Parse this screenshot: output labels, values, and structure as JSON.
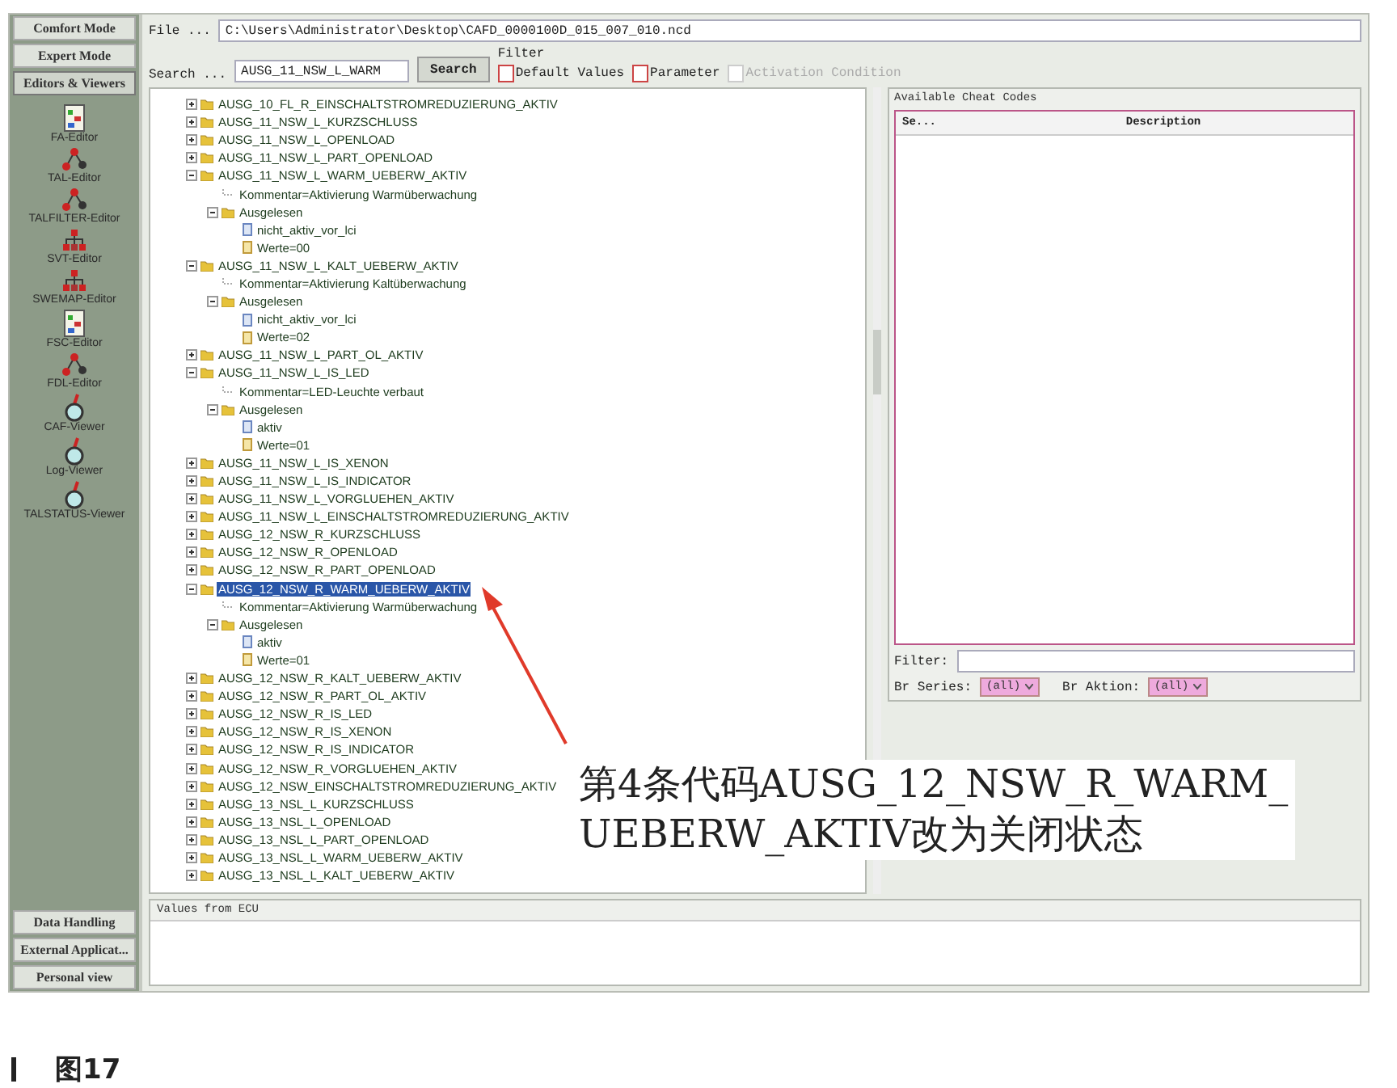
{
  "sidebar": {
    "modes": [
      {
        "label": "Comfort Mode",
        "selected": false
      },
      {
        "label": "Expert Mode",
        "selected": false
      },
      {
        "label": "Editors & Viewers",
        "selected": true
      }
    ],
    "tools": [
      {
        "label": "FA-Editor",
        "kind": "sheet"
      },
      {
        "label": "TAL-Editor",
        "kind": "network"
      },
      {
        "label": "TALFILTER-Editor",
        "kind": "network"
      },
      {
        "label": "SVT-Editor",
        "kind": "hierarchy"
      },
      {
        "label": "SWEMAP-Editor",
        "kind": "hierarchy"
      },
      {
        "label": "FSC-Editor",
        "kind": "sheet"
      },
      {
        "label": "FDL-Editor",
        "kind": "network"
      },
      {
        "label": "CAF-Viewer",
        "kind": "lens"
      },
      {
        "label": "Log-Viewer",
        "kind": "lens"
      },
      {
        "label": "TALSTATUS-Viewer",
        "kind": "lens"
      }
    ],
    "bottom": [
      {
        "label": "Data Handling",
        "selected": false
      },
      {
        "label": "External Applicat...",
        "selected": false
      },
      {
        "label": "Personal view",
        "selected": false
      }
    ]
  },
  "file": {
    "label": "File ...",
    "value": "C:\\Users\\Administrator\\Desktop\\CAFD_0000100D_015_007_010.ncd"
  },
  "search": {
    "label": "Search ...",
    "value": "AUSG_11_NSW_L_WARM",
    "button": "Search"
  },
  "filter": {
    "title": "Filter",
    "options": [
      {
        "label": "Default Values",
        "checked": false,
        "disabled": false
      },
      {
        "label": "Parameter",
        "checked": false,
        "disabled": false
      },
      {
        "label": "Activation Condition",
        "checked": false,
        "disabled": true
      }
    ]
  },
  "tree": [
    {
      "label": "AUSG_10_FL_R_EINSCHALTSTROMREDUZIERUNG_AKTIV",
      "kind": "folder",
      "expanded": false,
      "selected": false
    },
    {
      "label": "AUSG_11_NSW_L_KURZSCHLUSS",
      "kind": "folder",
      "expanded": false,
      "selected": false
    },
    {
      "label": "AUSG_11_NSW_L_OPENLOAD",
      "kind": "folder",
      "expanded": false,
      "selected": false
    },
    {
      "label": "AUSG_11_NSW_L_PART_OPENLOAD",
      "kind": "folder",
      "expanded": false,
      "selected": false
    },
    {
      "label": "AUSG_11_NSW_L_WARM_UEBERW_AKTIV",
      "kind": "folder",
      "expanded": true,
      "selected": false,
      "children": [
        {
          "label": "Kommentar=Aktivierung Warmüberwachung",
          "kind": "comment",
          "selected": false
        },
        {
          "label": "Ausgelesen",
          "kind": "folder",
          "expanded": true,
          "selected": false,
          "children": [
            {
              "label": "nicht_aktiv_vor_lci",
              "kind": "status",
              "selected": false
            },
            {
              "label": "Werte=00",
              "kind": "value",
              "selected": false
            }
          ]
        }
      ]
    },
    {
      "label": "AUSG_11_NSW_L_KALT_UEBERW_AKTIV",
      "kind": "folder",
      "expanded": true,
      "selected": false,
      "children": [
        {
          "label": "Kommentar=Aktivierung Kaltüberwachung",
          "kind": "comment",
          "selected": false
        },
        {
          "label": "Ausgelesen",
          "kind": "folder",
          "expanded": true,
          "selected": false,
          "children": [
            {
              "label": "nicht_aktiv_vor_lci",
              "kind": "status",
              "selected": false
            },
            {
              "label": "Werte=02",
              "kind": "value",
              "selected": false
            }
          ]
        }
      ]
    },
    {
      "label": "AUSG_11_NSW_L_PART_OL_AKTIV",
      "kind": "folder",
      "expanded": false,
      "selected": false
    },
    {
      "label": "AUSG_11_NSW_L_IS_LED",
      "kind": "folder",
      "expanded": true,
      "selected": false,
      "children": [
        {
          "label": "Kommentar=LED-Leuchte verbaut",
          "kind": "comment",
          "selected": false
        },
        {
          "label": "Ausgelesen",
          "kind": "folder",
          "expanded": true,
          "selected": false,
          "children": [
            {
              "label": "aktiv",
              "kind": "status",
              "selected": false
            },
            {
              "label": "Werte=01",
              "kind": "value",
              "selected": false
            }
          ]
        }
      ]
    },
    {
      "label": "AUSG_11_NSW_L_IS_XENON",
      "kind": "folder",
      "expanded": false,
      "selected": false
    },
    {
      "label": "AUSG_11_NSW_L_IS_INDICATOR",
      "kind": "folder",
      "expanded": false,
      "selected": false
    },
    {
      "label": "AUSG_11_NSW_L_VORGLUEHEN_AKTIV",
      "kind": "folder",
      "expanded": false,
      "selected": false
    },
    {
      "label": "AUSG_11_NSW_L_EINSCHALTSTROMREDUZIERUNG_AKTIV",
      "kind": "folder",
      "expanded": false,
      "selected": false
    },
    {
      "label": "AUSG_12_NSW_R_KURZSCHLUSS",
      "kind": "folder",
      "expanded": false,
      "selected": false
    },
    {
      "label": "AUSG_12_NSW_R_OPENLOAD",
      "kind": "folder",
      "expanded": false,
      "selected": false
    },
    {
      "label": "AUSG_12_NSW_R_PART_OPENLOAD",
      "kind": "folder",
      "expanded": false,
      "selected": false
    },
    {
      "label": "AUSG_12_NSW_R_WARM_UEBERW_AKTIV",
      "kind": "folder",
      "expanded": true,
      "selected": true,
      "children": [
        {
          "label": "Kommentar=Aktivierung Warmüberwachung",
          "kind": "comment",
          "selected": false
        },
        {
          "label": "Ausgelesen",
          "kind": "folder",
          "expanded": true,
          "selected": false,
          "children": [
            {
              "label": "aktiv",
              "kind": "status",
              "selected": false
            },
            {
              "label": "Werte=01",
              "kind": "value",
              "selected": false
            }
          ]
        }
      ]
    },
    {
      "label": "AUSG_12_NSW_R_KALT_UEBERW_AKTIV",
      "kind": "folder",
      "expanded": false,
      "selected": false
    },
    {
      "label": "AUSG_12_NSW_R_PART_OL_AKTIV",
      "kind": "folder",
      "expanded": false,
      "selected": false
    },
    {
      "label": "AUSG_12_NSW_R_IS_LED",
      "kind": "folder",
      "expanded": false,
      "selected": false
    },
    {
      "label": "AUSG_12_NSW_R_IS_XENON",
      "kind": "folder",
      "expanded": false,
      "selected": false
    },
    {
      "label": "AUSG_12_NSW_R_IS_INDICATOR",
      "kind": "folder",
      "expanded": false,
      "selected": false
    },
    {
      "label": "AUSG_12_NSW_R_VORGLUEHEN_AKTIV",
      "kind": "folder",
      "expanded": false,
      "selected": false
    },
    {
      "label": "AUSG_12_NSW_EINSCHALTSTROMREDUZIERUNG_AKTIV",
      "kind": "folder",
      "expanded": false,
      "selected": false
    },
    {
      "label": "AUSG_13_NSL_L_KURZSCHLUSS",
      "kind": "folder",
      "expanded": false,
      "selected": false
    },
    {
      "label": "AUSG_13_NSL_L_OPENLOAD",
      "kind": "folder",
      "expanded": false,
      "selected": false
    },
    {
      "label": "AUSG_13_NSL_L_PART_OPENLOAD",
      "kind": "folder",
      "expanded": false,
      "selected": false
    },
    {
      "label": "AUSG_13_NSL_L_WARM_UEBERW_AKTIV",
      "kind": "folder",
      "expanded": false,
      "selected": false
    },
    {
      "label": "AUSG_13_NSL_L_KALT_UEBERW_AKTIV",
      "kind": "folder",
      "expanded": false,
      "selected": false
    }
  ],
  "cheat_codes": {
    "title": "Available Cheat Codes",
    "columns": [
      "Se...",
      "Description"
    ],
    "filter_label": "Filter:",
    "selectors": [
      {
        "label": "Br Series:",
        "value": "(all)"
      },
      {
        "label": "Br Aktion:",
        "value": "(all)"
      }
    ]
  },
  "values_panel": {
    "title": "Values from ECU"
  },
  "annotation": {
    "lines": [
      "第4条代码AUSG_12_NSW_R_WARM_",
      "UEBERW_AKTIV改为关闭状态"
    ]
  },
  "figure_caption": "图17"
}
